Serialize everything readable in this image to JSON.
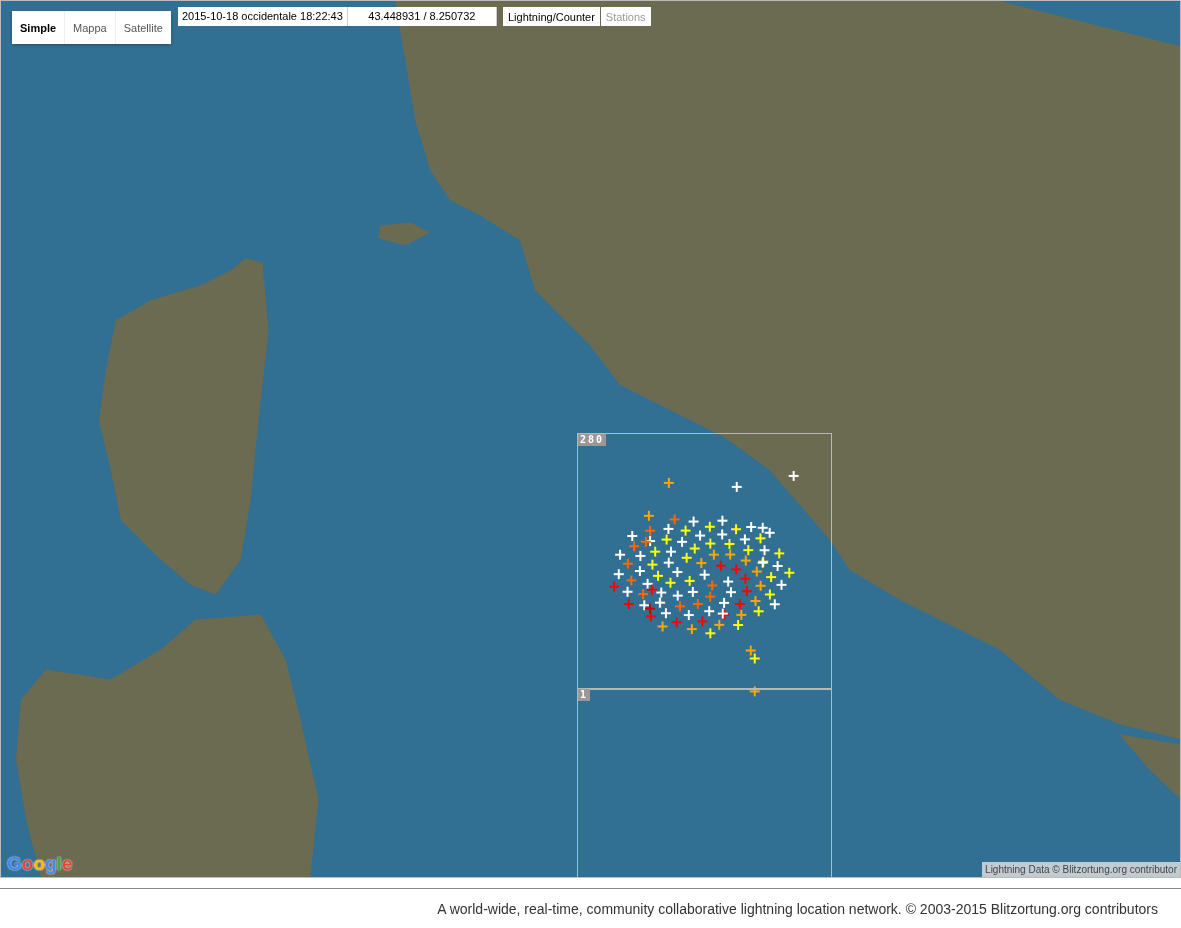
{
  "map_type_tabs": [
    {
      "label": "Simple",
      "selected": true
    },
    {
      "label": "Mappa",
      "selected": false
    },
    {
      "label": "Satellite",
      "selected": false
    }
  ],
  "info": {
    "datetime": "2015-10-18 occidentale 18:22:43",
    "coordinates": "43.448931 / 8.250732"
  },
  "layer_tabs": [
    {
      "label": "Lightning/Counter",
      "selected": true
    },
    {
      "label": "Stations",
      "selected": false
    }
  ],
  "counter_cells": [
    {
      "count": "280"
    },
    {
      "count": "1"
    }
  ],
  "map_logo": "Google",
  "map_attribution": "Lightning Data © Blitzortung.org contributor",
  "footer": "A world-wide, real-time, community collaborative lightning location network. © 2003-2015 Blitzortung.org contributors"
}
